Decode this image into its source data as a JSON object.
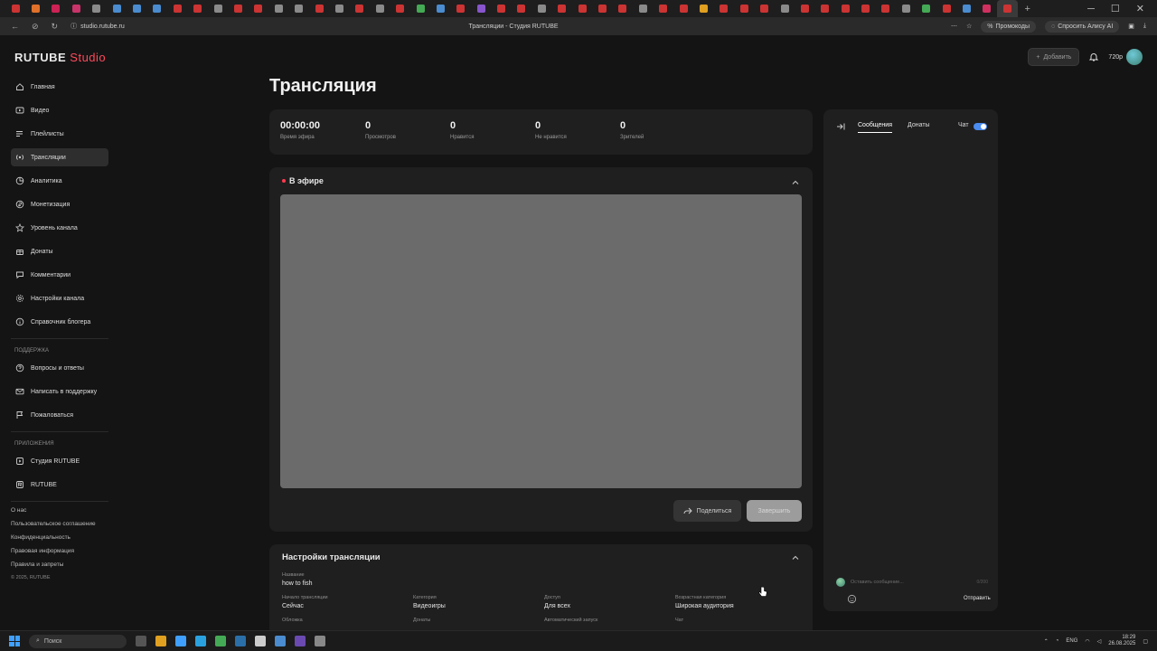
{
  "browser": {
    "url": "studio.rutube.ru",
    "page_title": "Трансляции - Студия RUTUBE",
    "promo_label": "Промокоды",
    "alice_label": "Спросить Алису AI",
    "tab_colors": [
      "#cc3333",
      "#e0712a",
      "#cc2255",
      "#c8346a",
      "#8a8a8a",
      "#4a8ccf",
      "#4a8ccf",
      "#4a8ccf",
      "#cc3333",
      "#cc3333",
      "#8a8a8a",
      "#cc3333",
      "#cc3333",
      "#8a8a8a",
      "#8a8a8a",
      "#cc3333",
      "#8a8a8a",
      "#cc3333",
      "#8a8a8a",
      "#cc3333",
      "#44aa55",
      "#4a8ccf",
      "#cc3333",
      "#8855cc",
      "#cc3333",
      "#cc3333",
      "#8a8a8a",
      "#cc3333",
      "#cc3333",
      "#cc3333",
      "#cc3333",
      "#8a8a8a",
      "#cc3333",
      "#cc3333",
      "#e0a020",
      "#cc3333",
      "#cc3333",
      "#cc3333",
      "#8a8a8a",
      "#cc3333",
      "#cc3333",
      "#cc3333",
      "#cc3333",
      "#cc3333",
      "#8a8a8a",
      "#44aa55",
      "#cc3333",
      "#4a8ccf",
      "#d03060",
      "#cc3333"
    ],
    "active_tab_index": 49
  },
  "header": {
    "logo_main": "RUTUBE",
    "logo_studio": "Studio",
    "add_button": "Добавить",
    "quality": "720p"
  },
  "sidebar": {
    "items": [
      {
        "label": "Главная",
        "icon": "home-icon"
      },
      {
        "label": "Видео",
        "icon": "video-icon"
      },
      {
        "label": "Плейлисты",
        "icon": "playlist-icon"
      },
      {
        "label": "Трансляции",
        "icon": "broadcast-icon",
        "active": true
      },
      {
        "label": "Аналитика",
        "icon": "analytics-icon"
      },
      {
        "label": "Монетизация",
        "icon": "money-icon"
      },
      {
        "label": "Уровень канала",
        "icon": "star-icon"
      },
      {
        "label": "Донаты",
        "icon": "donate-icon"
      },
      {
        "label": "Комментарии",
        "icon": "comment-icon"
      },
      {
        "label": "Настройки канала",
        "icon": "gear-icon"
      },
      {
        "label": "Справочник блогера",
        "icon": "info-icon"
      }
    ],
    "support_label": "ПОДДЕРЖКА",
    "support_items": [
      {
        "label": "Вопросы и ответы",
        "icon": "help-icon"
      },
      {
        "label": "Написать в поддержку",
        "icon": "mail-icon"
      },
      {
        "label": "Пожаловаться",
        "icon": "flag-icon"
      }
    ],
    "apps_label": "ПРИЛОЖЕНИЯ",
    "app_items": [
      {
        "label": "Студия RUTUBE",
        "icon": "studio-app-icon"
      },
      {
        "label": "RUTUBE",
        "icon": "rutube-app-icon"
      }
    ],
    "footer_links": [
      "О нас",
      "Пользовательское соглашение",
      "Конфиденциальность",
      "Правовая информация",
      "Правила и запреты"
    ],
    "copyright": "© 2025, RUTUBE"
  },
  "main": {
    "title": "Трансляция",
    "stats": [
      {
        "value": "00:00:00",
        "label": "Время эфира"
      },
      {
        "value": "0",
        "label": "Просмотров"
      },
      {
        "value": "0",
        "label": "Нравится"
      },
      {
        "value": "0",
        "label": "Не нравится"
      },
      {
        "value": "0",
        "label": "Зрителей"
      }
    ],
    "live_title": "В эфире",
    "share_button": "Поделиться",
    "end_button": "Завершить",
    "settings": {
      "title": "Настройки трансляции",
      "name_label": "Название",
      "name_value": "how to fish",
      "fields": [
        {
          "label": "Начало трансляции",
          "value": "Сейчас"
        },
        {
          "label": "Категория",
          "value": "Видеоигры"
        },
        {
          "label": "Доступ",
          "value": "Для всех"
        },
        {
          "label": "Возрастная категория",
          "value": "Широкая аудитория"
        }
      ],
      "row3": [
        "Обложка",
        "Донаты",
        "Автоматический запуск",
        "Чат"
      ]
    }
  },
  "chat": {
    "tab_messages": "Сообщения",
    "tab_donates": "Донаты",
    "chat_toggle_label": "Чат",
    "chat_enabled": true,
    "input_placeholder": "Оставить сообщение...",
    "counter": "0/200",
    "send_label": "Отправить"
  },
  "taskbar": {
    "search_label": "Поиск",
    "lang": "ENG",
    "time": "18:29",
    "date": "26.08.2025"
  }
}
